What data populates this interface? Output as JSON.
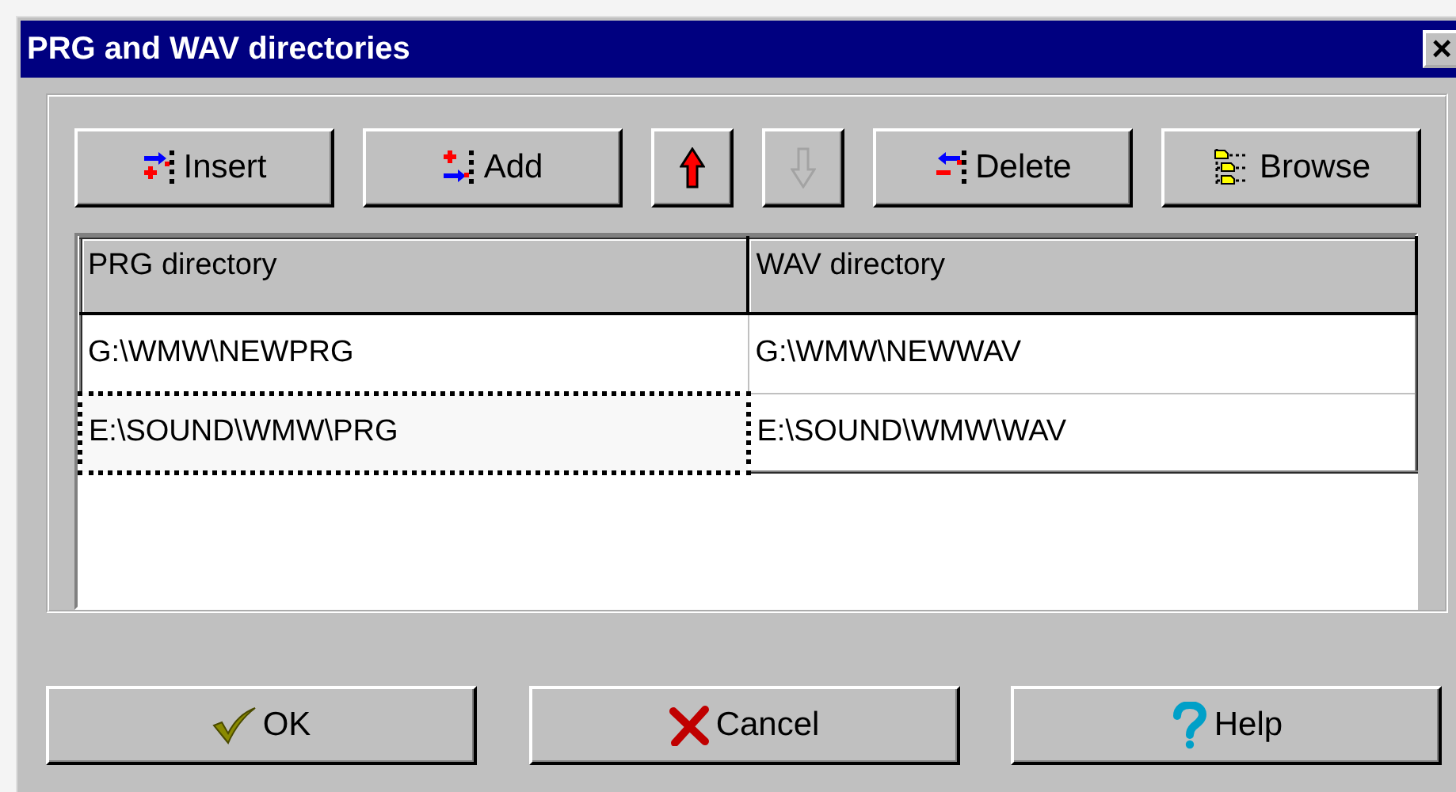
{
  "window": {
    "title": "PRG and WAV directories",
    "close": "×"
  },
  "toolbar": [
    {
      "kind": "insert",
      "label": "Insert",
      "disabled": false
    },
    {
      "kind": "add",
      "label": "Add",
      "disabled": false
    },
    {
      "kind": "up",
      "disabled": false
    },
    {
      "kind": "down",
      "disabled": true
    },
    {
      "kind": "delete",
      "label": "Delete",
      "disabled": false
    },
    {
      "kind": "browse",
      "label": "Browse",
      "disabled": false
    }
  ],
  "table": {
    "columns": [
      "PRG directory",
      "WAV directory"
    ],
    "rows": [
      {
        "cells": [
          "G:\\WMW\\NEWPRG",
          "G:\\WMW\\NEWWAV"
        ],
        "focused": false
      },
      {
        "cells": [
          "E:\\SOUND\\WMW\\PRG",
          "E:\\SOUND\\WMW\\WAV"
        ],
        "focused": true
      }
    ]
  },
  "buttons": [
    {
      "kind": "ok",
      "label": "OK"
    },
    {
      "kind": "cancel",
      "label": "Cancel"
    },
    {
      "kind": "help",
      "label": "Help"
    }
  ]
}
